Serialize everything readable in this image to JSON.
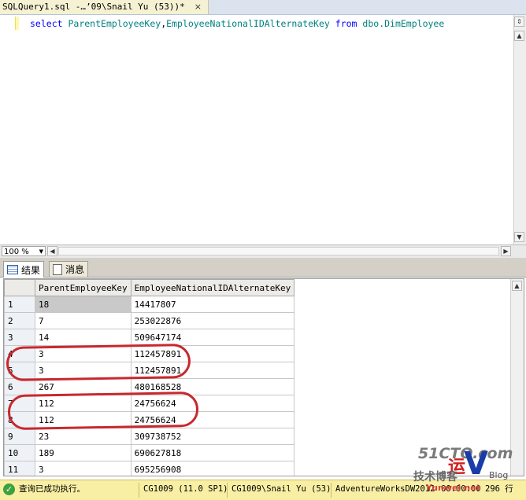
{
  "tab": {
    "title": "SQLQuery1.sql -…’09\\Snail Yu (53))*",
    "close": "×"
  },
  "editor": {
    "kw_select": "select",
    "col1": "ParentEmployeeKey",
    "comma": ",",
    "col2": "EmployeeNationalIDAlternateKey",
    "kw_from": "from",
    "table": "dbo.DimEmployee"
  },
  "zoom": {
    "value": "100 %"
  },
  "result_tabs": [
    {
      "label": "结果",
      "icon": "grid-icon"
    },
    {
      "label": "消息",
      "icon": "message-icon"
    }
  ],
  "grid": {
    "columns": [
      "ParentEmployeeKey",
      "EmployeeNationalIDAlternateKey"
    ],
    "rows": [
      {
        "n": "1",
        "a": "18",
        "b": "14417807"
      },
      {
        "n": "2",
        "a": "7",
        "b": "253022876"
      },
      {
        "n": "3",
        "a": "14",
        "b": "509647174"
      },
      {
        "n": "4",
        "a": "3",
        "b": "112457891"
      },
      {
        "n": "5",
        "a": "3",
        "b": "112457891"
      },
      {
        "n": "6",
        "a": "267",
        "b": "480168528"
      },
      {
        "n": "7",
        "a": "112",
        "b": "24756624"
      },
      {
        "n": "8",
        "a": "112",
        "b": "24756624"
      },
      {
        "n": "9",
        "a": "23",
        "b": "309738752"
      },
      {
        "n": "10",
        "a": "189",
        "b": "690627818"
      },
      {
        "n": "11",
        "a": "3",
        "b": "695256908"
      }
    ]
  },
  "status": {
    "message": "查询已成功执行。",
    "server": "CG1009 (11.0 SP1)",
    "user": "CG1009\\Snail Yu (53)",
    "database": "AdventureWorksDW2012",
    "time": "00:00:00",
    "rows": "296 行"
  },
  "watermark": {
    "site": "51CTO.com",
    "tagline": "技术博客",
    "blog": "Blog",
    "brand": "Yunwei.net"
  },
  "colors": {
    "keyword": "#0000ff",
    "identifier": "#008080",
    "annotation": "#c8282d",
    "status_bg": "#f8efa4"
  }
}
